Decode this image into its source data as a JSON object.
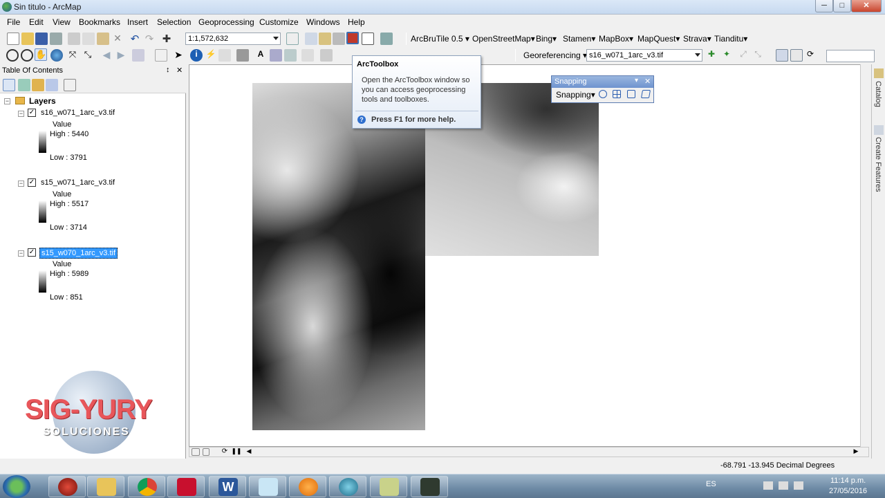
{
  "window": {
    "title": "Sin titulo - ArcMap",
    "min": "─",
    "max": "□",
    "close": "✕"
  },
  "menus": [
    "File",
    "Edit",
    "View",
    "Bookmarks",
    "Insert",
    "Selection",
    "Geoprocessing",
    "Customize",
    "Windows",
    "Help"
  ],
  "toolbar": {
    "scale": "1:1,572,632",
    "arcbrutile": "ArcBruTile 0.5",
    "basemaps": [
      "OpenStreetMap",
      "Bing",
      "Stamen",
      "MapBox",
      "MapQuest",
      "Strava",
      "Tianditu"
    ],
    "georeferencing_label": "Georeferencing",
    "georeferencing_layer": "s16_w071_1arc_v3.tif",
    "search_value": ""
  },
  "toc": {
    "title": "Table Of Contents",
    "pin": "↕",
    "close": "✕",
    "root": "Layers",
    "layers": [
      {
        "name": "s16_w071_1arc_v3.tif",
        "value_label": "Value",
        "high": "High : 5440",
        "low": "Low : 3791",
        "checked": "✓"
      },
      {
        "name": "s15_w071_1arc_v3.tif",
        "value_label": "Value",
        "high": "High : 5517",
        "low": "Low : 3714",
        "checked": "✓"
      },
      {
        "name": "s15_w070_1arc_v3.tif",
        "value_label": "Value",
        "high": "High : 5989",
        "low": "Low : 851",
        "checked": "✓"
      }
    ]
  },
  "watermark": {
    "line1": "SIG-YURY",
    "line2": "SOLUCIONES"
  },
  "tooltip": {
    "title": "ArcToolbox",
    "body": "Open the ArcToolbox window so you can access geoprocessing tools and toolboxes.",
    "help": "Press F1 for more help."
  },
  "snapping": {
    "title": "Snapping",
    "dropdown": "Snapping",
    "close": "✕"
  },
  "status": {
    "coords": "-68.791  -13.945 Decimal Degrees"
  },
  "right_panel": {
    "catalog": "Catalog",
    "create_features": "Create Features"
  },
  "taskbar": {
    "lang": "ES",
    "time": "11:14 p.m.",
    "date": "27/05/2016",
    "apps": [
      "start",
      "red-app",
      "explorer",
      "chrome",
      "acrobat",
      "word",
      "notepad",
      "media-player",
      "arccatalog",
      "arcmap",
      "georef-tool"
    ]
  },
  "colors": {
    "selection": "#3399ff",
    "titlebar": "#c6d9f0",
    "taskbar": "#6d8aa5"
  }
}
